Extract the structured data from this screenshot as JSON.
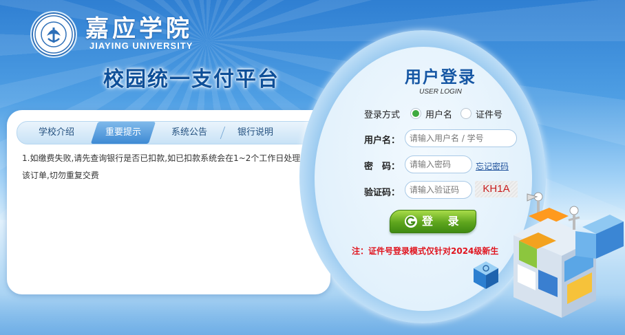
{
  "header": {
    "school_name": "嘉应学院",
    "school_name_en": "JIAYING UNIVERSITY",
    "emblem_text": "JIAYING UNIVERSITY",
    "platform_title": "校园统一支付平台"
  },
  "tabs": [
    {
      "label": "学校介绍",
      "active": false
    },
    {
      "label": "重要提示",
      "active": true
    },
    {
      "label": "系统公告",
      "active": false
    },
    {
      "label": "银行说明",
      "active": false
    }
  ],
  "notice": {
    "text": "1.如缴费失败,请先查询银行是否已扣款,如已扣款系统会在1~2个工作日处理该订单,切勿重复交费"
  },
  "login": {
    "title": "用户登录",
    "subtitle": "USER LOGIN",
    "mode_label": "登录方式",
    "mode_options": [
      "用户名",
      "证件号"
    ],
    "mode_selected": "用户名",
    "username_label": "用户名：",
    "username_placeholder": "请输入用户名 / 学号",
    "password_label": "密　码：",
    "password_placeholder": "请输入密码",
    "forgot_label": "忘记密码",
    "captcha_label": "验证码：",
    "captcha_placeholder": "请输入验证码",
    "captcha_text": "KH1A",
    "submit_label": "登 录",
    "note": "注：证件号登录模式仅针对2024级新生"
  },
  "colors": {
    "accent_blue": "#1657a4",
    "button_green": "#5ea51d",
    "warning_red": "#e0141e"
  }
}
